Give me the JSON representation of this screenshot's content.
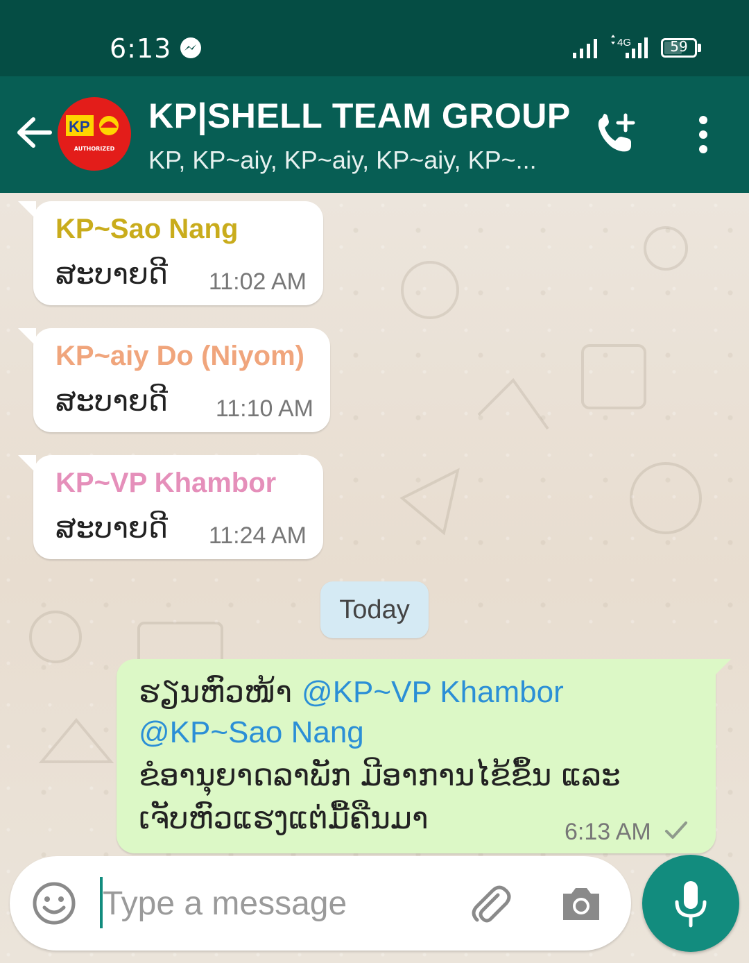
{
  "status_bar": {
    "time": "6:13",
    "network_label": "4G",
    "battery": "59"
  },
  "header": {
    "title": "KP|SHELL TEAM GROUP",
    "members": "KP, KP~aiy, KP~aiy, KP~aiy, KP~...",
    "avatar_text": "KP"
  },
  "messages": [
    {
      "sender": "KP~Sao Nang",
      "sender_color": "#c9ac1c",
      "text": "ສະບາຍດີ",
      "time": "11:02 AM"
    },
    {
      "sender": "KP~aiy Do (Niyom)",
      "sender_color": "#f0a57c",
      "text": "ສະບາຍດີ",
      "time": "11:10 AM"
    },
    {
      "sender": "KP~VP Khambor",
      "sender_color": "#e58fba",
      "text": "ສະບາຍດີ",
      "time": "11:24 AM"
    }
  ],
  "date_divider": "Today",
  "outgoing": {
    "line1_prefix": "ຮຽນຫົວໜ້າ ",
    "mention1": "@KP~VP Khambor",
    "mention2": "@KP~Sao Nang",
    "line3": "ຂໍອານຸຍາດລາພັກ ມີອາການໄຂ້ຂຶ້ນ ແລະ",
    "line4": "ເຈັບຫົວແຮງແຕ່ມື້ຄືນມາ",
    "time": "6:13 AM",
    "status": "sent"
  },
  "composer": {
    "placeholder": "Type a message"
  },
  "colors": {
    "status_bar": "#054d44",
    "header": "#075e54",
    "outgoing_bubble": "#dcf8c6",
    "mention": "#2b8fd6",
    "mic_button": "#128c7e"
  }
}
